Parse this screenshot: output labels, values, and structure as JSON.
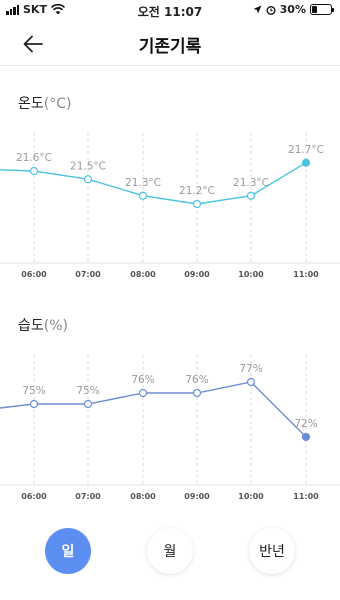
{
  "status_bar": {
    "carrier": "SKT",
    "time": "오전 11:07",
    "battery": "30%",
    "battery_level": 0.3
  },
  "header": {
    "title": "기존기록",
    "back_icon": "arrow-left-icon"
  },
  "temperature": {
    "title": "온도",
    "unit": "(°C)"
  },
  "humidity": {
    "title": "습도",
    "unit": "(%)"
  },
  "tabs": [
    {
      "label": "일",
      "active": true
    },
    {
      "label": "월",
      "active": false
    },
    {
      "label": "반년",
      "active": false
    }
  ],
  "colors": {
    "temperature_line": "#4cc3e0",
    "humidity_line": "#6b8ed6",
    "accent": "#5b8ef0",
    "label": "#999999"
  },
  "chart_data": [
    {
      "type": "line",
      "categories": [
        "06:00",
        "07:00",
        "08:00",
        "09:00",
        "10:00",
        "11:00"
      ],
      "values": [
        21.6,
        21.5,
        21.3,
        21.2,
        21.3,
        21.7
      ],
      "data_labels": [
        "21.6°C",
        "21.5°C",
        "21.3°C",
        "21.2°C",
        "21.3°C",
        "21.7°C"
      ],
      "title": "온도(°C)",
      "ylim": [
        20.4,
        22.4
      ],
      "grid": "vertical-dashed"
    },
    {
      "type": "line",
      "categories": [
        "06:00",
        "07:00",
        "08:00",
        "09:00",
        "10:00",
        "11:00"
      ],
      "values": [
        75,
        75,
        76,
        76,
        77,
        72
      ],
      "data_labels": [
        "75%",
        "75%",
        "76%",
        "76%",
        "77%",
        "72%"
      ],
      "title": "습도(%)",
      "ylim": [
        67,
        82
      ],
      "grid": "vertical-dashed"
    }
  ]
}
